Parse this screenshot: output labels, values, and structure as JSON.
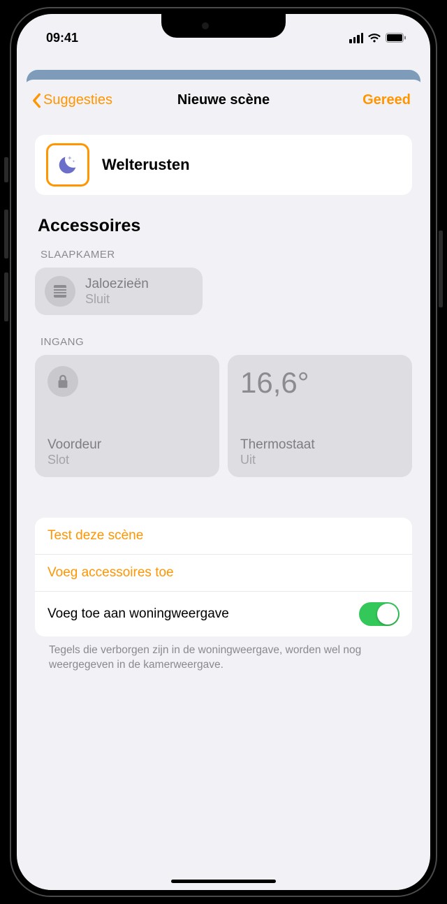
{
  "status": {
    "time": "09:41"
  },
  "nav": {
    "back": "Suggesties",
    "title": "Nieuwe scène",
    "done": "Gereed"
  },
  "scene": {
    "name": "Welterusten"
  },
  "section_accessories": "Accessoires",
  "groups": {
    "bedroom": {
      "label": "SLAAPKAMER",
      "tile": {
        "name": "Jaloezieën",
        "state": "Sluit"
      }
    },
    "entry": {
      "label": "INGANG",
      "door": {
        "name": "Voordeur",
        "state": "Slot"
      },
      "thermo": {
        "temp": "16,6°",
        "name": "Thermostaat",
        "state": "Uit"
      }
    }
  },
  "actions": {
    "test": "Test deze scène",
    "add": "Voeg accessoires toe",
    "home": "Voeg toe aan woningweergave"
  },
  "footer": "Tegels die verborgen zijn in de woningweergave, worden wel nog weergegeven in de kamerweergave."
}
